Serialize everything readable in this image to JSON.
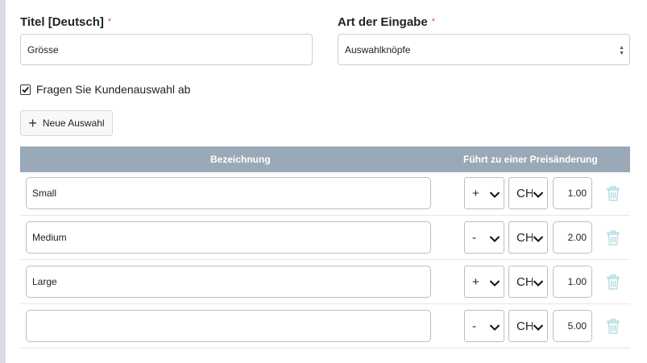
{
  "form": {
    "title_label": "Titel [Deutsch]",
    "required_mark": "*",
    "title_value": "Grösse",
    "input_type_label": "Art der Eingabe",
    "input_type_value": "Auswahlknöpfe",
    "checkbox_label": "Fragen Sie Kundenauswahl ab",
    "checkbox_checked": true,
    "add_button_label": "Neue Auswahl"
  },
  "table": {
    "headers": [
      "Bezeichnung",
      "Führt zu einer Preisänderung"
    ],
    "rows": [
      {
        "name": "Small",
        "sign": "+",
        "currency": "CH",
        "price": "1.00"
      },
      {
        "name": "Medium",
        "sign": "-",
        "currency": "CH",
        "price": "2.00"
      },
      {
        "name": "Large",
        "sign": "+",
        "currency": "CH",
        "price": "1.00"
      },
      {
        "name": "",
        "sign": "-",
        "currency": "CH",
        "price": "5.00"
      }
    ]
  },
  "colors": {
    "header_bg": "#9aa9b7",
    "required": "#d9534f",
    "trash_icon": "#a8d8dc"
  }
}
